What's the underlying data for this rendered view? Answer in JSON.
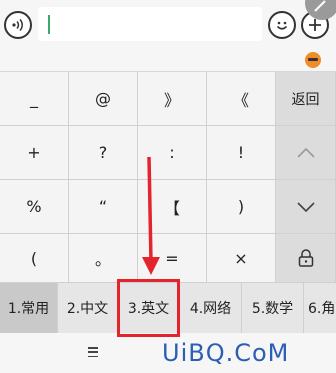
{
  "input_bar": {
    "text_value": "",
    "icons": [
      "voice-icon",
      "emoji-icon",
      "plus-icon"
    ]
  },
  "keys": {
    "row1": [
      "_",
      "@",
      "》",
      "《"
    ],
    "row2": [
      "+",
      "?",
      ":",
      "!"
    ],
    "row3": [
      "%",
      "“",
      "【",
      ")"
    ],
    "row4": [
      "(",
      "。",
      "=",
      "×"
    ],
    "side": {
      "back_label": "返回",
      "icons": [
        "chevron-up-icon",
        "chevron-down-icon",
        "lock-icon"
      ]
    }
  },
  "candidates": [
    {
      "label": "1.常用",
      "active": true
    },
    {
      "label": "2.中文",
      "active": false
    },
    {
      "label": "3.英文",
      "active": false
    },
    {
      "label": "4.网络",
      "active": false
    },
    {
      "label": "5.数学",
      "active": false
    },
    {
      "label": "6.角",
      "active": false
    }
  ],
  "bottom": {
    "watermark": "UiBQ.CoM",
    "icons": [
      "menu-icon"
    ]
  },
  "colors": {
    "highlight": "#e4242c",
    "accent_caret": "#3aa96b",
    "watermark": "#2b5fb5"
  }
}
